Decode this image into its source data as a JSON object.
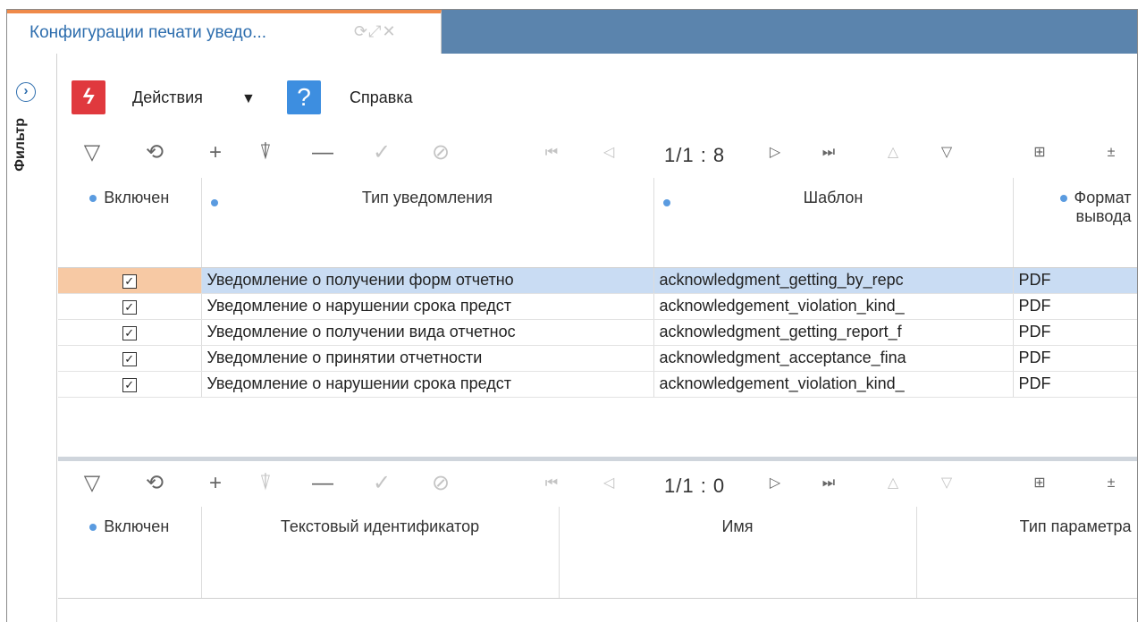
{
  "tab": {
    "title": "Конфигурации печати уведо...",
    "icons": [
      "refresh-icon",
      "expand-icon",
      "close-icon"
    ]
  },
  "sidebar": {
    "filter_label": "Фильтр"
  },
  "toolbar": {
    "actions_label": "Действия",
    "actions_caret": "▼",
    "help_label": "Справка",
    "help_glyph": "?",
    "actions_glyph": "ϟ"
  },
  "grid1": {
    "pager": "1/1 : 8",
    "columns": [
      "Включен",
      "Тип уведомления",
      "Шаблон",
      "Формат вывода"
    ],
    "rows": [
      {
        "enabled": "✓",
        "type": "Уведомление о получении форм отчетно",
        "template": "acknowledgment_getting_by_repc",
        "format": "PDF"
      },
      {
        "enabled": "✓",
        "type": "Уведомление о нарушении срока предст",
        "template": "acknowledgement_violation_kind_",
        "format": "PDF"
      },
      {
        "enabled": "✓",
        "type": "Уведомление о получении вида отчетнос",
        "template": "acknowledgment_getting_report_f",
        "format": "PDF"
      },
      {
        "enabled": "✓",
        "type": "Уведомление о принятии отчетности",
        "template": "acknowledgment_acceptance_fina",
        "format": "PDF"
      },
      {
        "enabled": "✓",
        "type": "Уведомление о нарушении срока предст",
        "template": "acknowledgement_violation_kind_",
        "format": "PDF"
      }
    ]
  },
  "grid2": {
    "pager": "1/1 : 0",
    "columns": [
      "Включен",
      "Текстовый идентификатор",
      "Имя",
      "Тип параметра"
    ]
  },
  "colors": {
    "accent_blue": "#5b84ad",
    "tab_top": "#ef8a4a",
    "actions_red": "#e0393e",
    "help_blue": "#3d8ee0",
    "row_selected": "#c9dcf3"
  }
}
